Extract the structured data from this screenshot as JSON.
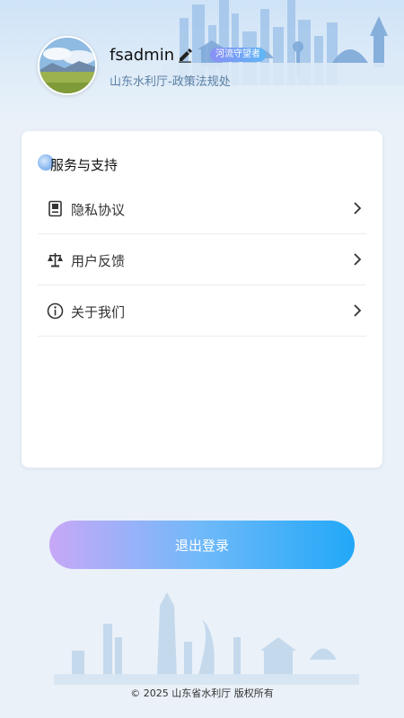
{
  "profile": {
    "username": "fsadmin",
    "badge": "河流守望者",
    "organization": "山东水利厅-政策法规处"
  },
  "section": {
    "title": "服务与支持",
    "items": [
      {
        "label": "隐私协议",
        "icon": "document-icon"
      },
      {
        "label": "用户反馈",
        "icon": "scale-icon"
      },
      {
        "label": "关于我们",
        "icon": "info-icon"
      }
    ]
  },
  "logout_label": "退出登录",
  "footer": {
    "copyright": "© 2025 山东省水利厅 版权所有"
  },
  "colors": {
    "accent_start": "#c7a8f7",
    "accent_end": "#22a8f7",
    "org_text": "#5a7fa3"
  }
}
